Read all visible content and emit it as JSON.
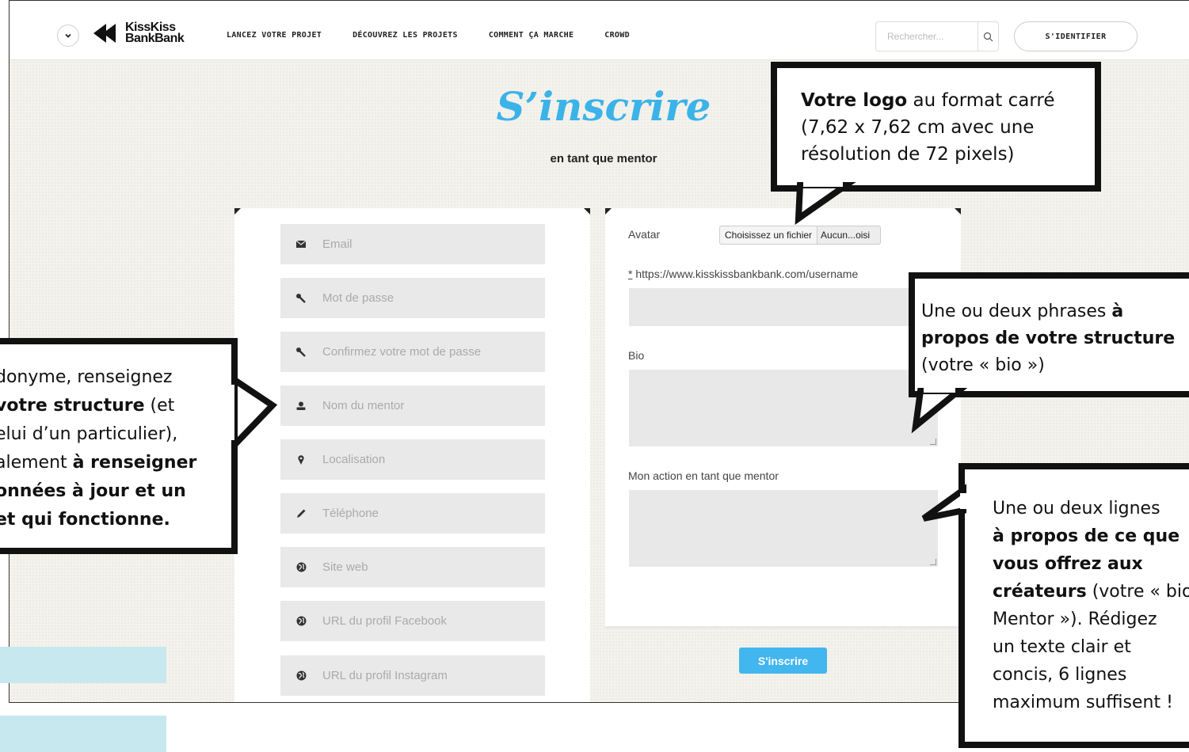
{
  "header": {
    "logo_line1": "KissKiss",
    "logo_line2": "BankBank",
    "nav": [
      "LANCEZ VOTRE PROJET",
      "DÉCOUVREZ LES PROJETS",
      "COMMENT ÇA MARCHE",
      "CROWD"
    ],
    "search_placeholder": "Rechercher...",
    "login_label": "S'IDENTIFIER"
  },
  "page": {
    "title": "S’inscrire",
    "subtitle": "en tant que mentor"
  },
  "form_left": {
    "fields": [
      {
        "placeholder": "Email",
        "icon": "envelope-icon"
      },
      {
        "placeholder": "Mot de passe",
        "icon": "key-icon"
      },
      {
        "placeholder": "Confirmez votre mot de passe",
        "icon": "key-icon"
      },
      {
        "placeholder": "Nom du mentor",
        "icon": "user-icon"
      },
      {
        "placeholder": "Localisation",
        "icon": "map-pin-icon"
      },
      {
        "placeholder": "Téléphone",
        "icon": "pencil-icon"
      },
      {
        "placeholder": "Site web",
        "icon": "globe-icon"
      },
      {
        "placeholder": "URL du profil Facebook",
        "icon": "globe-icon"
      },
      {
        "placeholder": "URL du profil Instagram",
        "icon": "globe-icon"
      }
    ]
  },
  "form_right": {
    "avatar_label": "Avatar",
    "file_button": "Choisissez un fichier",
    "file_name": "Aucun...oisi",
    "url_required_mark": "*",
    "url_label": "https://www.kisskissbankbank.com/username",
    "bio_label": "Bio",
    "action_label": "Mon action en tant que mentor",
    "submit_label": "S'inscrire"
  },
  "callouts": {
    "logo": {
      "bold": "Votre logo",
      "text1": " au format carré",
      "line2": "(7,62 x 7,62 cm avec une",
      "line3": "résolution de 72 pixels)"
    },
    "bio": {
      "text1": "Une ou deux phrases ",
      "bold1": "à",
      "bold2": "propos de votre structure",
      "line3": "(votre « bio »)"
    },
    "action": {
      "line1": "Une ou deux lignes",
      "bold1": "à propos de ce que",
      "bold2": "vous offrez aux",
      "bold3": "créateurs",
      "text4": " (votre « bio",
      "line5": "Mentor »). Rédigez",
      "line6": "un texte clair et",
      "line7": "concis, 6 lignes",
      "line8": "maximum suffisent !"
    },
    "name": {
      "line1": "donyme, renseignez",
      "bold2": "votre structure",
      "text2": " (et",
      "line3": "elui d’un particulier),",
      "text4": "alement ",
      "bold4": "à renseigner",
      "bold5": "onnées à jour et un",
      "bold6": "et qui fonctionne."
    }
  }
}
